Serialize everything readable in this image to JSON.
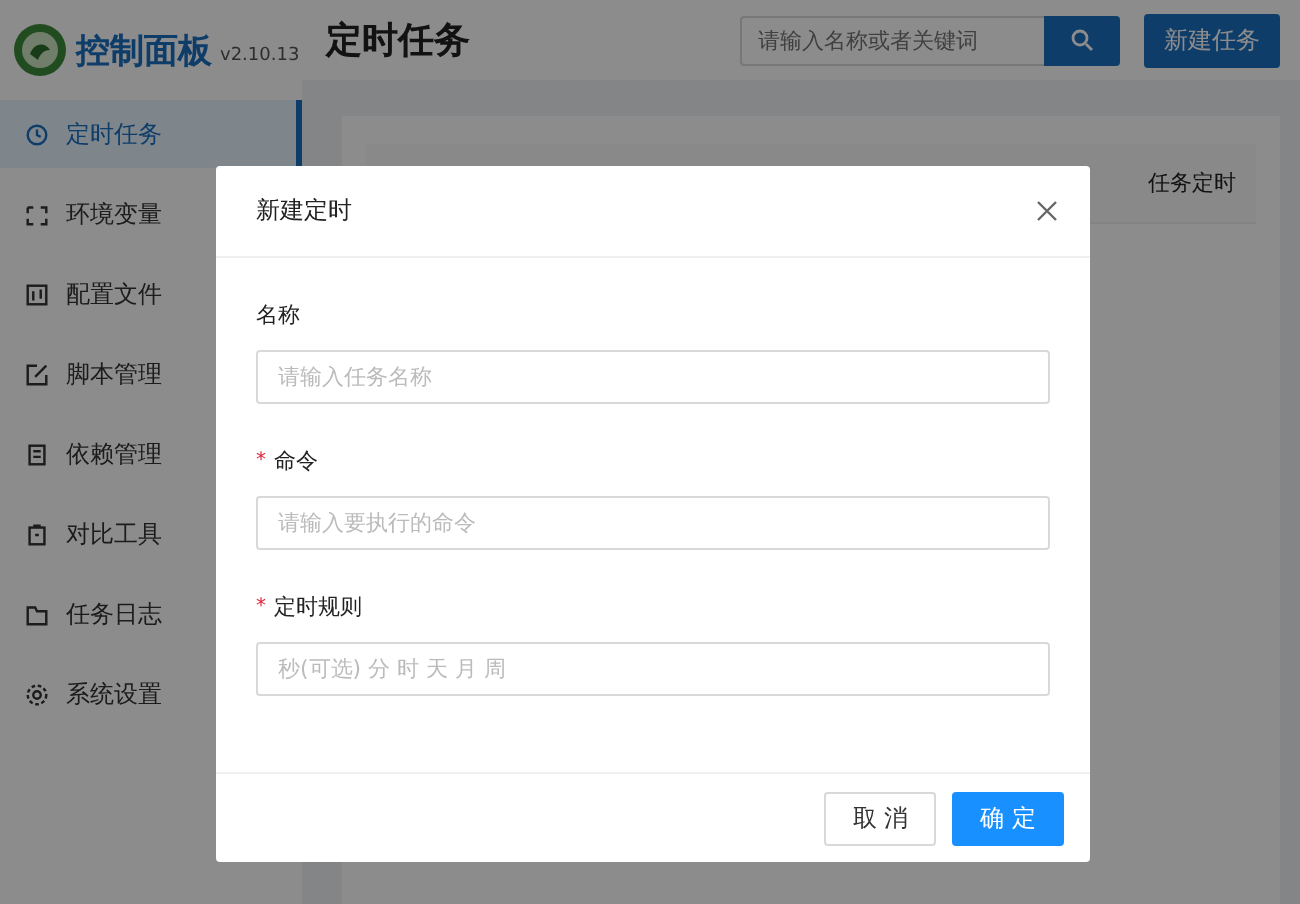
{
  "sidebar": {
    "logo": {
      "title": "控制面板",
      "version": "v2.10.13"
    },
    "items": [
      {
        "label": "定时任务",
        "selected": true
      },
      {
        "label": "环境变量",
        "selected": false
      },
      {
        "label": "配置文件",
        "selected": false
      },
      {
        "label": "脚本管理",
        "selected": false
      },
      {
        "label": "依赖管理",
        "selected": false
      },
      {
        "label": "对比工具",
        "selected": false
      },
      {
        "label": "任务日志",
        "selected": false
      },
      {
        "label": "系统设置",
        "selected": false
      }
    ]
  },
  "header": {
    "title": "定时任务",
    "search": {
      "placeholder": "请输入名称或者关键词"
    },
    "new_button": "新建任务"
  },
  "table": {
    "columns": [
      {
        "label": "任务定时"
      }
    ]
  },
  "dialog": {
    "title": "新建定时",
    "fields": [
      {
        "label": "名称",
        "placeholder": "请输入任务名称"
      },
      {
        "label": "命令",
        "required_mark": "*",
        "placeholder": "请输入要执行的命令"
      },
      {
        "label": "定时规则",
        "required_mark": "*",
        "placeholder": "秒(可选) 分 时 天 月 周"
      }
    ],
    "cancel": "取 消",
    "ok": "确 定"
  }
}
